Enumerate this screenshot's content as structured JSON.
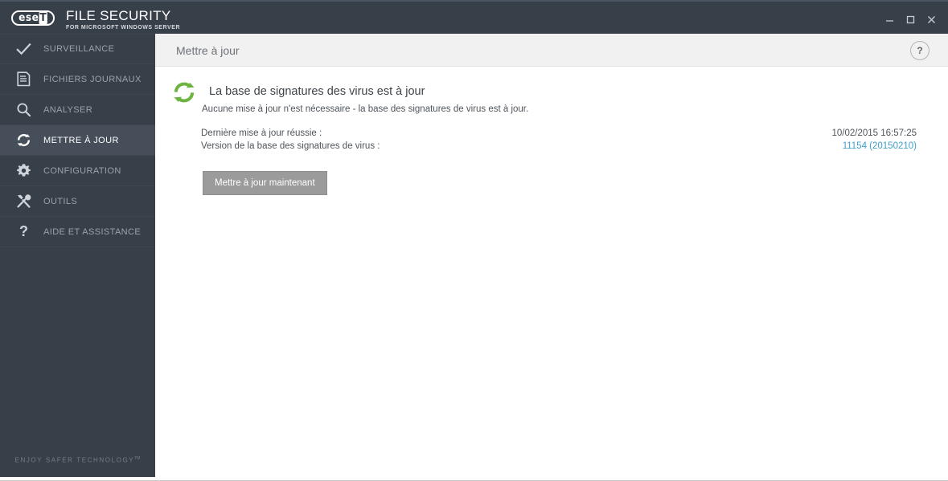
{
  "titlebar": {
    "logo_text_prefix": "ese",
    "logo_text_suffix": "T",
    "product_name": "FILE SECURITY",
    "product_subtitle": "FOR MICROSOFT WINDOWS SERVER",
    "minimize_label": "Minimize",
    "maximize_label": "Maximize",
    "close_label": "Close"
  },
  "sidebar": {
    "items": [
      {
        "label": "SURVEILLANCE",
        "icon": "check-icon",
        "active": false
      },
      {
        "label": "FICHIERS JOURNAUX",
        "icon": "log-file-icon",
        "active": false
      },
      {
        "label": "ANALYSER",
        "icon": "magnifier-icon",
        "active": false
      },
      {
        "label": "METTRE À JOUR",
        "icon": "refresh-icon",
        "active": true
      },
      {
        "label": "CONFIGURATION",
        "icon": "gear-icon",
        "active": false
      },
      {
        "label": "OUTILS",
        "icon": "tools-icon",
        "active": false
      },
      {
        "label": "AIDE ET ASSISTANCE",
        "icon": "question-mark-icon",
        "active": false
      }
    ],
    "tagline": "ENJOY SAFER TECHNOLOGY",
    "tagline_sup": "TM"
  },
  "content_header": {
    "page_title": "Mettre à jour",
    "help_label": "?"
  },
  "main": {
    "status_heading": "La base de signatures des virus est à jour",
    "status_subtext": "Aucune mise à jour n'est nécessaire - la base des signatures de virus est à jour.",
    "status_icon": "green-refresh-icon",
    "details": [
      {
        "label": "Dernière mise à jour réussie :",
        "value": "10/02/2015 16:57:25",
        "is_link": false
      },
      {
        "label": "Version de la base des signatures de virus :",
        "value": "11154 (20150210)",
        "is_link": true
      }
    ],
    "update_button_label": "Mettre à jour maintenant"
  },
  "colors": {
    "sidebar_bg": "#373f49",
    "sidebar_active": "#454e59",
    "accent_green": "#6cb33f",
    "link_blue": "#3f9fc9",
    "header_bg": "#f1f1f1",
    "button_grey": "#9b9b9b"
  }
}
